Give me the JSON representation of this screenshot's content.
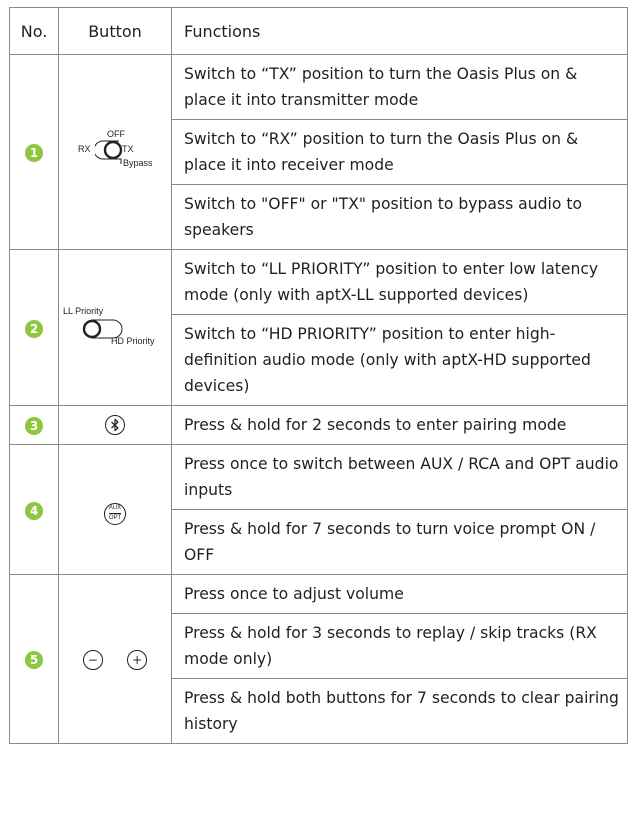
{
  "header": {
    "no": "No.",
    "button": "Button",
    "functions": "Functions"
  },
  "rows": [
    {
      "no": "1",
      "labels": {
        "off": "OFF",
        "rx": "RX",
        "tx": "TX",
        "bypass": "Bypass"
      },
      "functions": [
        "Switch to “TX” position to turn the Oasis Plus on & place it into transmitter mode",
        "Switch to “RX” position to turn the Oasis Plus on & place it into receiver mode",
        "Switch to \"OFF\" or \"TX\" position to bypass audio to speakers"
      ]
    },
    {
      "no": "2",
      "labels": {
        "ll": "LL Priority",
        "hd": "HD Priority"
      },
      "functions": [
        "Switch to “LL PRIORITY” position to enter low latency mode (only with aptX-LL supported devices)",
        "Switch to “HD PRIORITY” position to enter high-definition audio mode (only with aptX-HD supported devices)"
      ]
    },
    {
      "no": "3",
      "functions": [
        "Press & hold for 2 seconds to enter pairing mode"
      ]
    },
    {
      "no": "4",
      "labels": {
        "aux": "AUX",
        "opt": "OPT"
      },
      "functions": [
        "Press once to switch between AUX / RCA and OPT audio inputs",
        "Press & hold for 7 seconds to turn voice prompt ON / OFF"
      ]
    },
    {
      "no": "5",
      "labels": {
        "minus": "−",
        "plus": "+"
      },
      "functions": [
        "Press once to adjust volume",
        "Press & hold for 3 seconds to replay / skip tracks (RX mode only)",
        "Press & hold both buttons for 7 seconds to clear pairing history"
      ]
    }
  ],
  "colors": {
    "badge": "#8dc63f",
    "border": "#8a8a8a",
    "text": "#231f20"
  }
}
